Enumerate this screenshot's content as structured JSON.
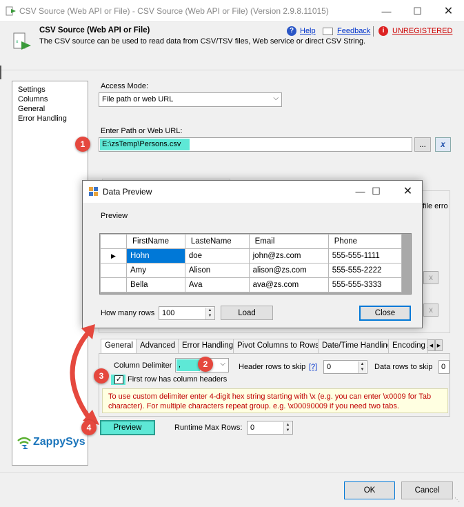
{
  "window": {
    "title": "CSV Source (Web API or File) - CSV Source (Web API or File) (Version 2.9.8.11015)"
  },
  "header": {
    "heading": "CSV Source (Web API or File)",
    "description": "The CSV source can be used to read data from CSV/TSV files, Web service or direct CSV String.",
    "help_label": "Help",
    "feedback_label": "Feedback",
    "unregistered_label": "UNREGISTERED"
  },
  "sidebar": {
    "items": [
      {
        "label": "Settings"
      },
      {
        "label": "Columns"
      },
      {
        "label": "General"
      },
      {
        "label": "Error Handling"
      }
    ]
  },
  "main": {
    "access_mode_label": "Access Mode:",
    "access_mode_value": "File path or web URL",
    "path_label": "Enter Path or Web URL:",
    "path_value": "E:\\zsTemp\\Persons.csv",
    "browse_label": "...",
    "file_error_partial": "file erro"
  },
  "dialog": {
    "title": "Data Preview",
    "group_label": "Preview",
    "columns": [
      "FirstName",
      "LasteName",
      "Email",
      "Phone"
    ],
    "rows": [
      [
        "Hohn",
        "doe",
        "john@zs.com",
        "555-555-1111"
      ],
      [
        "Amy",
        "Alison",
        "alison@zs.com",
        "555-555-2222"
      ],
      [
        "Bella",
        "Ava",
        "ava@zs.com",
        "555-555-3333"
      ]
    ],
    "rows_label": "How many rows",
    "rows_value": "100",
    "load_label": "Load",
    "close_label": "Close"
  },
  "tabs": [
    {
      "label": "General"
    },
    {
      "label": "Advanced"
    },
    {
      "label": "Error Handling"
    },
    {
      "label": "Pivot Columns to Rows"
    },
    {
      "label": "Date/Time Handling"
    },
    {
      "label": "Encoding A"
    }
  ],
  "general": {
    "delimiter_label": "Column Delimiter",
    "delimiter_value": ",",
    "header_skip_label": "Header rows to skip",
    "header_skip_help": "[?]",
    "header_skip_value": "0",
    "data_skip_label": "Data rows to skip",
    "data_skip_value": "0",
    "first_row_label": "First row has column headers",
    "note": "To use custom delimiter enter 4-digit hex string starting with \\x (e.g. you can enter \\x0009 for Tab character). For multiple characters repeat group. e.g. \\x00090009 if you need two tabs."
  },
  "bottom": {
    "preview_label": "Preview",
    "runtime_label": "Runtime Max Rows:",
    "runtime_value": "0",
    "ok_label": "OK",
    "cancel_label": "Cancel"
  },
  "logo": {
    "text": "ZappySys"
  },
  "badges": [
    "1",
    "2",
    "3",
    "4"
  ],
  "colors": {
    "highlight": "#5ee8d6",
    "badge": "#e5483e",
    "arrow": "#e5483e",
    "link": "#0033cc",
    "unregistered": "#cc0000",
    "logo_green": "#5ab031",
    "logo_blue": "#1b75bb"
  }
}
